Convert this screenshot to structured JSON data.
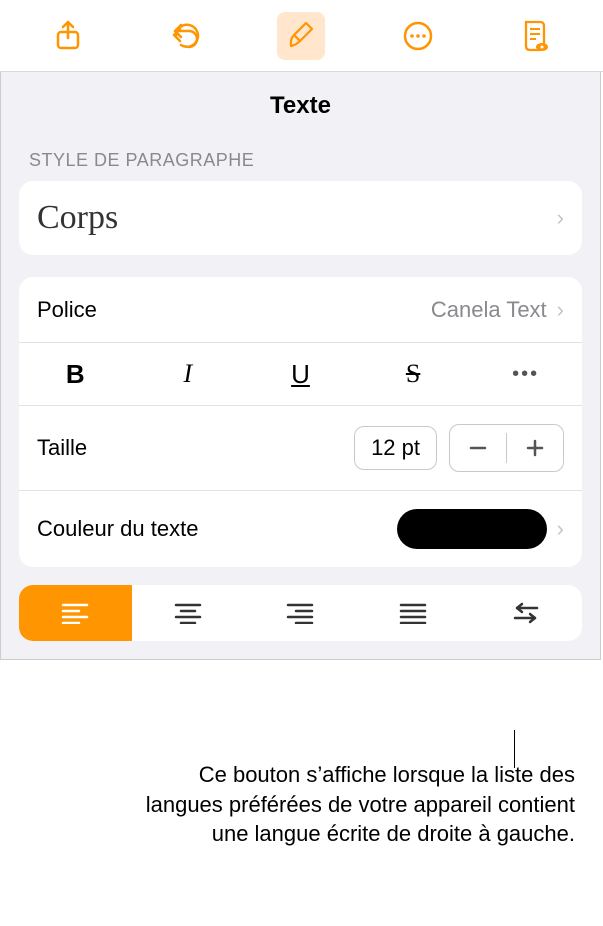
{
  "toolbar": {
    "share": "share-icon",
    "undo": "undo-icon",
    "format": "paintbrush-icon",
    "more": "more-icon",
    "reader": "reader-icon"
  },
  "panel": {
    "title": "Texte",
    "section_paragraph": "STYLE DE PARAGRAPHE",
    "style_name": "Corps",
    "font_label": "Police",
    "font_value": "Canela Text",
    "format": {
      "bold": "B",
      "italic": "I",
      "underline": "U",
      "strike": "S",
      "more": "•••"
    },
    "size_label": "Taille",
    "size_value": "12 pt",
    "color_label": "Couleur du texte",
    "color_value": "#000000"
  },
  "callout": "Ce bouton s’affiche lorsque la liste des langues préférées de votre appareil contient une langue écrite de droite à gauche."
}
